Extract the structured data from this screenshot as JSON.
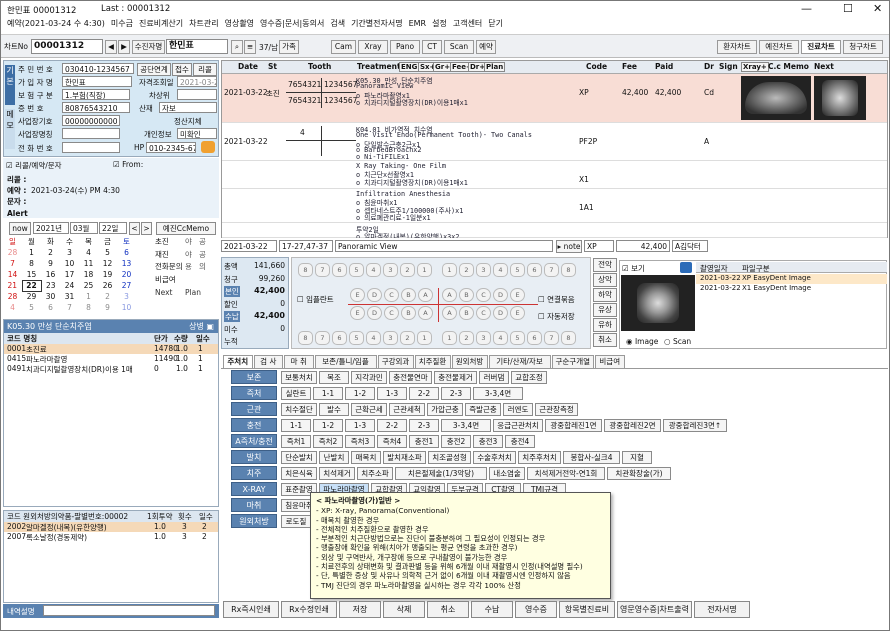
{
  "window": {
    "title": "한민표 00001312",
    "last": "Last : 00001312"
  },
  "menu": [
    "예약(2021-03-24 수 4:30)",
    "미수금",
    "진료비계산기",
    "차트관리",
    "영상촬영",
    "영수증|문서|동의서",
    "검색",
    "기간별전자서명",
    "EMR",
    "설정",
    "고객센터",
    "닫기"
  ],
  "toolbar": {
    "chart_no_label": "차트No",
    "chart_no": "00001312",
    "receipt_link": "수진자명",
    "name": "한민표",
    "count": "37/남",
    "buttons": [
      "가족",
      "Cam",
      "Xray",
      "Pano",
      "CT",
      "Scan",
      "예약"
    ],
    "right_tabs": [
      "환자차트",
      "예진차트",
      "진료차트",
      "청구차트"
    ],
    "active_tab": "진료차트"
  },
  "patient": {
    "labels": {
      "rrn": "주 민 번 호",
      "subscriber": "가 입 자 명",
      "ins_type": "보 험 구 분",
      "id_no": "증 번 호",
      "org_no": "사업장기호",
      "org_name": "사업장명칭",
      "phone": "전 화 번 호",
      "hp": "HP",
      "last_visit": "자격조회일",
      "paid": "차상위",
      "exempt": "산재",
      "disabled": "정산지체",
      "personal": "개인정보"
    },
    "rrn": "030410-1234567",
    "subscriber": "한민표",
    "ins_type": "1.부험(직장)",
    "id_no": "80876543210",
    "org_no": "00000000000",
    "phone": "",
    "hp": "010-2345-6789",
    "qual_date": "2021-03-22",
    "exempt_val": "자보",
    "personal_val": "미확인",
    "buttons": [
      "공단연계",
      "접수",
      "리콜"
    ],
    "side_tabs": [
      "기본",
      "메모"
    ]
  },
  "recall": {
    "checkbox": "리콜/예약/문자",
    "from": "From:",
    "recall_label": "리콜 :",
    "reserve_label": "예약 :",
    "reserve_val": "2021-03-24(수) PM 4:30",
    "msg_label": "문자 :",
    "alert_label": "Alert"
  },
  "calendar": {
    "today": "now",
    "year": "2021년",
    "month": "03월",
    "day": "22일",
    "memo_btn": "예진CcMemo",
    "days": [
      "일",
      "월",
      "화",
      "수",
      "목",
      "금",
      "토"
    ],
    "weeks": [
      [
        "28",
        "1",
        "2",
        "3",
        "4",
        "5",
        "6"
      ],
      [
        "7",
        "8",
        "9",
        "10",
        "11",
        "12",
        "13"
      ],
      [
        "14",
        "15",
        "16",
        "17",
        "18",
        "19",
        "20"
      ],
      [
        "21",
        "22",
        "23",
        "24",
        "25",
        "26",
        "27"
      ],
      [
        "28",
        "29",
        "30",
        "31",
        "1",
        "2",
        "3"
      ],
      [
        "4",
        "5",
        "6",
        "7",
        "8",
        "9",
        "10"
      ]
    ],
    "side": [
      [
        "초진",
        "야",
        "공"
      ],
      [
        "재진",
        "야",
        "공"
      ],
      [
        "전화문의",
        "용",
        "의"
      ],
      [
        "비급여",
        ""
      ],
      [
        "Next",
        "Plan"
      ]
    ]
  },
  "diag": {
    "header": "K05.30 만성 단순치주염",
    "col_code": "코드 명칭",
    "col_price": "단가",
    "col_qty": "수량",
    "col_days": "일수",
    "rows": [
      [
        "0001",
        "초진료",
        "14780",
        "1.0",
        "1"
      ],
      [
        "0415",
        "파노라마촬영",
        "11490",
        "1.0",
        "1"
      ],
      [
        "0491",
        "치과디지털촬영장치(DR)이용 1매",
        "0",
        "1.0",
        "1"
      ]
    ]
  },
  "rx": {
    "header": "코드 원외처방의약품-팔별번호:00002",
    "col_dose": "1회투약",
    "col_times": "횟수",
    "col_days": "일수",
    "rows": [
      [
        "2002",
        "알마겔정(내복)(유한양행)",
        "1.0",
        "3",
        "2"
      ],
      [
        "2007",
        "록소날정(경동제약)",
        "1.0",
        "3",
        "2"
      ]
    ],
    "memo_label": "내역설명"
  },
  "chart": {
    "cols": [
      "Date",
      "St",
      "Tooth",
      "Treatment",
      "ENG",
      "Sx+",
      "Gr+",
      "Fee+",
      "Dr+",
      "Plan",
      "Code",
      "Fee",
      "Paid",
      "Dr",
      "Sign",
      "Xray+",
      "C.c Memo",
      "Next"
    ],
    "rows": [
      {
        "date": "2021-03-22",
        "st": "초진",
        "tooth": [
          "7654321",
          "1234567",
          "7654321",
          "1234567"
        ],
        "tx": [
          "K05.30 만성 단순치주염",
          "Panoramic View",
          "o 파노라마촬영x1",
          "o 치과디지털촬영장치(DR)이용1매x1"
        ],
        "code": "XP",
        "fee": "42,400",
        "paid": "42,400",
        "dr": "Cd"
      },
      {
        "date": "2021-03-22",
        "st": "",
        "tooth": [
          "4"
        ],
        "tx": [
          "K04.01 비가역적 치수염",
          "One Visit Endo(Permanent Tooth)- Two Canals",
          "o 당일발수근충2근x1",
          "o BarbedBroachx2",
          "o Ni-TiFILEx1"
        ],
        "code": "PF2P",
        "fee": "",
        "paid": "",
        "dr": "A"
      },
      {
        "date": "",
        "st": "",
        "tooth": [],
        "tx": [
          "X Ray Taking- One Film",
          "o 치근단x선촬영x1",
          "o 치과디지털촬영장치(DR)이용1매x1"
        ],
        "code": "X1",
        "fee": "",
        "paid": "",
        "dr": ""
      },
      {
        "date": "",
        "st": "",
        "tooth": [],
        "tx": [
          "Infiltration Anesthesia",
          "o 침윤마취x1",
          "o 셉타네스트주1/100000(주사)x1",
          "o 의료폐관리료-1일분x1"
        ],
        "code": "1A1",
        "fee": "",
        "paid": "",
        "dr": ""
      },
      {
        "date": "",
        "st": "",
        "tooth": [],
        "tx": [
          "투약2일",
          "o 알마겔정(내복)(유한양행)x3x2"
        ],
        "code": "RX2",
        "fee": "",
        "paid": "",
        "dr": ""
      }
    ],
    "edit": {
      "date": "2021-03-22",
      "tooth": "17-27,47-37",
      "tx": "Panoramic View",
      "note_btn": "note",
      "code": "XP",
      "fee": "42,400",
      "dr": "A김닥터"
    }
  },
  "money": {
    "total_label": "총액",
    "total": "141,660",
    "claim_label": "청구",
    "claim": "99,260",
    "self_label": "본인",
    "self": "42,400",
    "disc_label": "할인",
    "disc": "0",
    "recv_label": "수납",
    "recv": "42,400",
    "unpaid_label": "미수",
    "unpaid": "0",
    "cum_label": "누적"
  },
  "teeth": {
    "upper_r": [
      "8",
      "7",
      "6",
      "5",
      "4",
      "3",
      "2",
      "1"
    ],
    "upper_l": [
      "1",
      "2",
      "3",
      "4",
      "5",
      "6",
      "7",
      "8"
    ],
    "prim_r": [
      "E",
      "D",
      "C",
      "B",
      "A"
    ],
    "prim_l": [
      "A",
      "B",
      "C",
      "D",
      "E"
    ],
    "implant": "임플란트",
    "bridge": "연결묶음",
    "auto": "자동저장"
  },
  "side_buttons": [
    "전악",
    "상악",
    "하악",
    "유상",
    "유하",
    "취소"
  ],
  "images": {
    "view": "보기",
    "col_date": "촬영일자",
    "col_type": "파일구분",
    "rows": [
      [
        "2021-03-22",
        "XP EasyDent Image"
      ],
      [
        "2021-03-22",
        "X1 EasyDent Image"
      ]
    ],
    "radio_image": "Image",
    "radio_scan": "Scan"
  },
  "tx_tabs": [
    "주처치",
    "검 사",
    "마 취",
    "보존/틀니/임플",
    "구강외과",
    "치주질환",
    "원외처방",
    "기타/산재/자보",
    "구순구개열",
    "비급여"
  ],
  "categories": [
    {
      "name": "보존",
      "items": [
        "보통처치",
        "복조",
        "지각과민",
        "충전물연마",
        "충전물제거",
        "러버댐",
        "교합조정"
      ]
    },
    {
      "name": "즉처",
      "items": [
        "실란트",
        "1-1",
        "1-2",
        "1-3",
        "2-2",
        "2-3",
        "3-3,4면"
      ]
    },
    {
      "name": "근관",
      "items": [
        "치수절단",
        "발수",
        "근확근세",
        "근관세척",
        "가압근충",
        "즉발근충",
        "러엔도",
        "근관장측정"
      ]
    },
    {
      "name": "충전",
      "items": [
        "1-1",
        "1-2",
        "1-3",
        "2-2",
        "2-3",
        "3-3,4면",
        "응급근관처치",
        "광중합레진1면",
        "광중합레진2면",
        "광중합레진3면↑"
      ]
    },
    {
      "name": "A즉처/충전",
      "items": [
        "즉처1",
        "즉처2",
        "즉처3",
        "즉처4",
        "충전1",
        "충전2",
        "충전3",
        "충전4"
      ]
    },
    {
      "name": "발치",
      "items": [
        "단순발치",
        "난발치",
        "매복치",
        "발치재소파",
        "치조골성형",
        "수술후처치",
        "치주후처치",
        "봉합사-실크4",
        "지혈"
      ]
    },
    {
      "name": "치주",
      "items": [
        "치은식육",
        "치석제거",
        "치주소파",
        "치은절제술(1/3악당)",
        "내소염술",
        "치석제거전악-연1회",
        "치관확장술(가)"
      ]
    },
    {
      "name": "X-RAY",
      "items": [
        "표준촬영",
        "파노라마촬영",
        "교합촬영",
        "교익촬영",
        "두부규격",
        "CT촬영",
        "TMJ규격"
      ]
    },
    {
      "name": "마취",
      "items": [
        "침윤마취"
      ]
    },
    {
      "name": "원외처방",
      "items": [
        "로도질"
      ]
    }
  ],
  "tooltip": {
    "title": "< 파노라마촬영(가)일반 >",
    "lines": [
      "- XP: X-ray, Panorama(Conventional)",
      "- 매복치 촬영한 경우",
      "- 전체적인 치주질환으로 촬영한 경우",
      "- 부분적인 치근단방법으로는 진단이 불충분하여 그 필요성이 인정되는 경우",
      "- 맹출장애 확인을 위해(치아가 맹출되는 평균 연령을 초과한 경우)",
      "- 외상 및 구역반사, 개구장애 등으로 구내촬영이 불가능한 경우",
      "- 치료전후의 상태변화 및 결과판별 등을 위해 6개월 이내 재촬영시 인정(내역설명 필수)",
      "- 단, 특별한 증상 및 사유나 의학적 근거 없이 6개월 이내 재촬영시엔 인정하지 않음",
      "- TMJ 진단의 경우 파노라마촬영을 실시하는 경우 각각 100% 산정"
    ]
  },
  "bottom": [
    "Rx즉시인쇄",
    "Rx수정인쇄",
    "저장",
    "삭제",
    "취소",
    "수납",
    "영수증",
    "항목별진료비",
    "영문영수증|차트출력",
    "전자서명"
  ]
}
